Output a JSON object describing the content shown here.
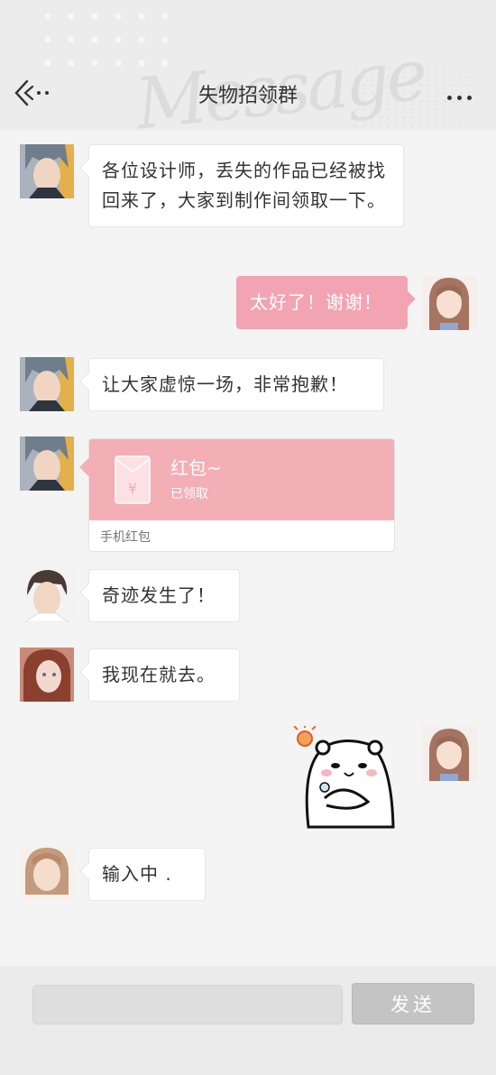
{
  "header": {
    "title": "失物招领群",
    "back_icon": "back-arrow-icon",
    "more_icon": "more-dots-icon"
  },
  "messages": [
    {
      "side": "left",
      "avatar": "gray-hair-man-avatar",
      "text": "各位设计师，丢失的作品已经被找回来了，大家到制作间领取一下。"
    },
    {
      "side": "right",
      "avatar": "brown-hair-girl-avatar",
      "text": "太好了！谢谢！"
    },
    {
      "side": "left",
      "avatar": "gray-hair-man-avatar",
      "text": "让大家虚惊一场，非常抱歉！"
    },
    {
      "side": "left",
      "avatar": "gray-hair-man-avatar",
      "type": "red-packet",
      "red_packet": {
        "title": "红包~",
        "status": "已领取",
        "footer": "手机红包"
      }
    },
    {
      "side": "left",
      "avatar": "dark-hair-man-avatar",
      "text": "奇迹发生了！"
    },
    {
      "side": "left",
      "avatar": "red-hair-woman-avatar",
      "text": "我现在就去。"
    },
    {
      "side": "right",
      "avatar": "brown-hair-girl-avatar",
      "type": "sticker",
      "sticker": "bear-sticker-icon"
    },
    {
      "side": "left",
      "avatar": "blonde-hair-girl-avatar",
      "text": "输入中 ."
    }
  ],
  "composer": {
    "input_value": "",
    "send_label": "发送"
  },
  "colors": {
    "accent_pink": "#f2a4b3",
    "red_packet": "#f3aeb6",
    "send_disabled": "#c4c4c4"
  }
}
